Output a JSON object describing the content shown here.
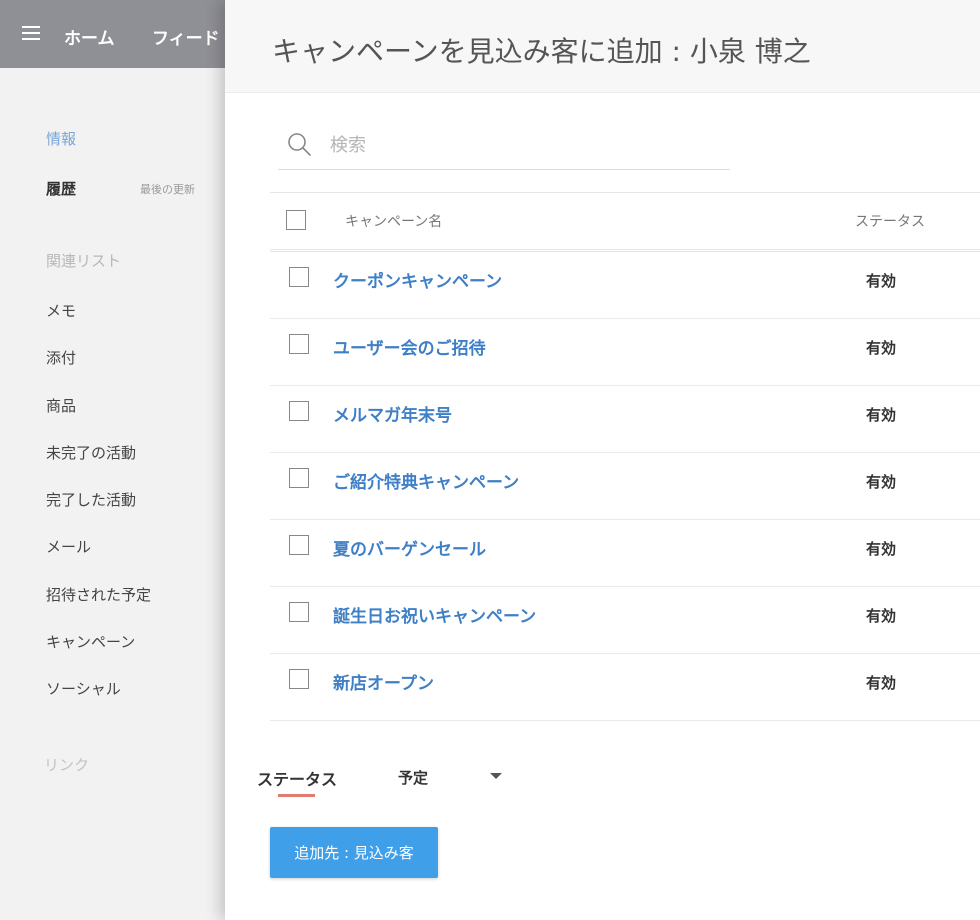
{
  "topbar": {
    "nav": [
      "ホーム",
      "フィード"
    ]
  },
  "sidebar": {
    "info": "情報",
    "history": "履歴",
    "last_updated": "最後の更新",
    "related_header": "関連リスト",
    "items": [
      "メモ",
      "添付",
      "商品",
      "未完了の活動",
      "完了した活動",
      "メール",
      "招待された予定",
      "キャンペーン",
      "ソーシャル"
    ],
    "link_header": "リンク"
  },
  "modal": {
    "title": "キャンペーンを見込み客に追加 : 小泉 博之",
    "search": {
      "placeholder": "検索",
      "value": ""
    },
    "table": {
      "headers": {
        "name": "キャンペーン名",
        "status": "ステータス"
      },
      "rows": [
        {
          "name": "クーポンキャンペーン",
          "status": "有効"
        },
        {
          "name": "ユーザー会のご招待",
          "status": "有効"
        },
        {
          "name": "メルマガ年末号",
          "status": "有効"
        },
        {
          "name": "ご紹介特典キャンペーン",
          "status": "有効"
        },
        {
          "name": "夏のバーゲンセール",
          "status": "有効"
        },
        {
          "name": "誕生日お祝いキャンペーン",
          "status": "有効"
        },
        {
          "name": "新店オープン",
          "status": "有効"
        }
      ]
    },
    "status_field": {
      "label": "ステータス",
      "value": "予定"
    },
    "add_button": "追加先 : 見込み客"
  },
  "colors": {
    "topbar": "#8f9096",
    "link": "#3f7fc6",
    "button": "#3f9fe8",
    "active_underline": "#e07b72",
    "sidebar_active": "#7aa6d6"
  }
}
